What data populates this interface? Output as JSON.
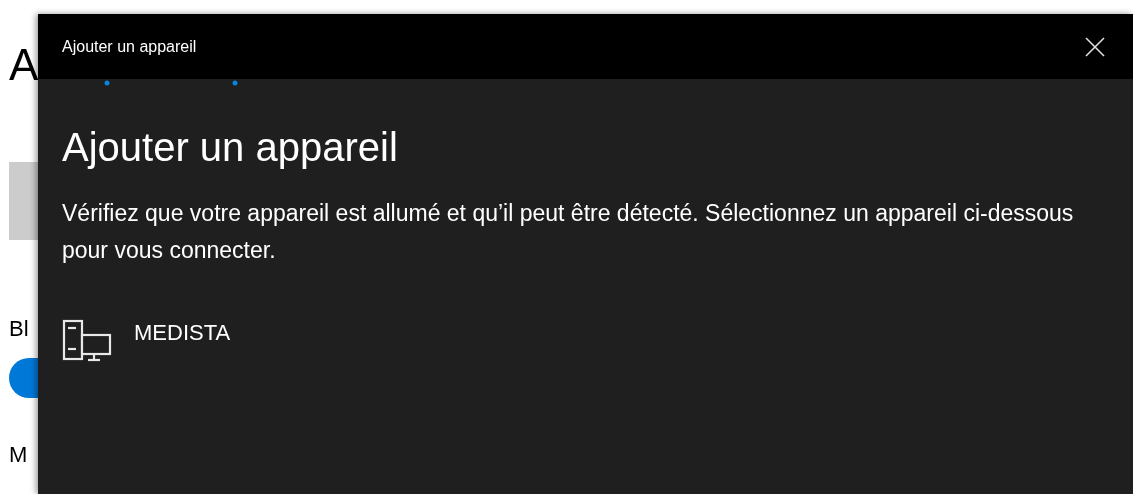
{
  "background_window": {
    "heading": "A",
    "label": "Bl",
    "toggle": {
      "on": true
    },
    "label_2": "M"
  },
  "dialog": {
    "title": "Ajouter un appareil",
    "heading": "Ajouter un appareil",
    "description": "Vérifiez que votre appareil est allumé et qu’il peut être détecté. Sélectionnez un appareil ci-dessous pour vous connecter.",
    "devices": [
      {
        "name": "MEDISTA",
        "kind": "computer"
      }
    ]
  }
}
